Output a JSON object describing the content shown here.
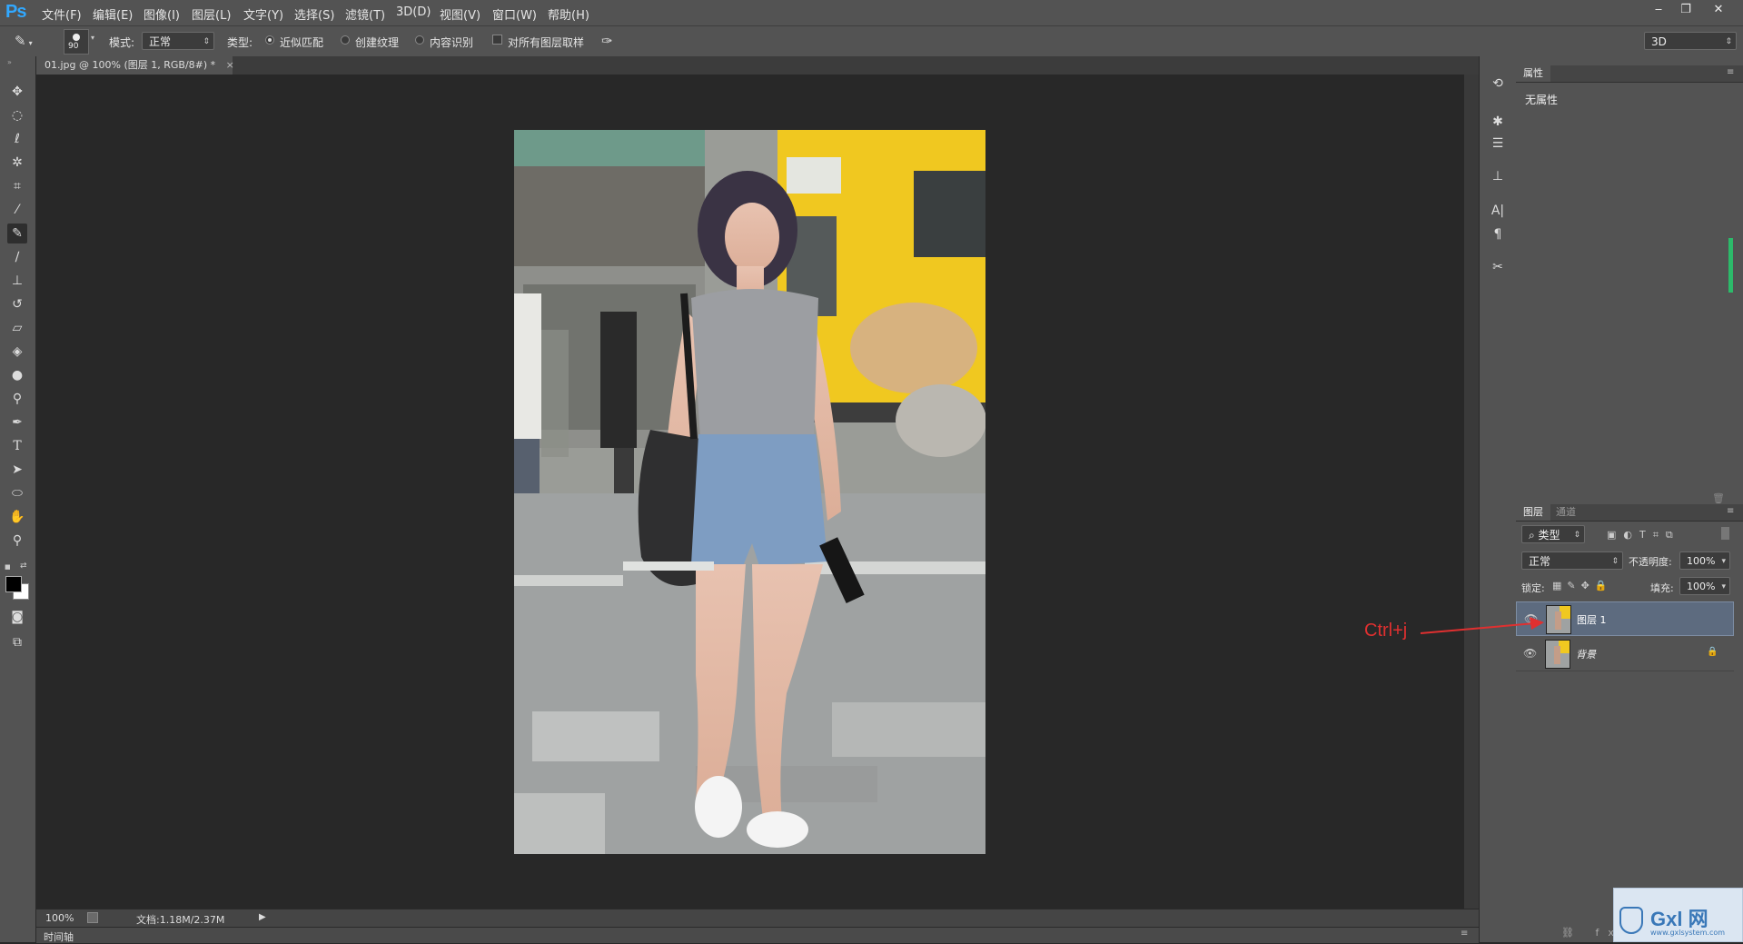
{
  "app": {
    "logo": "Ps"
  },
  "menu": [
    "文件(F)",
    "编辑(E)",
    "图像(I)",
    "图层(L)",
    "文字(Y)",
    "选择(S)",
    "滤镜(T)",
    "3D(D)",
    "视图(V)",
    "窗口(W)",
    "帮助(H)"
  ],
  "window_controls": {
    "minimize": "‒",
    "restore": "❐",
    "close": "✕"
  },
  "options": {
    "brush_size": "90",
    "mode_label": "模式:",
    "mode_value": "正常",
    "type_label": "类型:",
    "radio1": "近似匹配",
    "radio2": "创建纹理",
    "radio3": "内容识别",
    "sample_all": "对所有图层取样",
    "workspace": "3D"
  },
  "document": {
    "tab_title": "01.jpg @ 100% (图层 1, RGB/8#) *",
    "close": "×"
  },
  "status": {
    "zoom": "100%",
    "doc_info": "文档:1.18M/2.37M",
    "timeline": "时间轴"
  },
  "properties": {
    "tab": "属性",
    "content": "无属性"
  },
  "layers_panel": {
    "tab_layers": "图层",
    "tab_channels": "通道",
    "filter": "类型",
    "blend_mode": "正常",
    "opacity_label": "不透明度:",
    "opacity": "100%",
    "lock_label": "锁定:",
    "fill_label": "填充:",
    "fill": "100%",
    "layers": [
      {
        "name": "图层 1",
        "selected": true
      },
      {
        "name": "背景",
        "selected": false
      }
    ]
  },
  "annotation": {
    "text": "Ctrl+j",
    "color": "#e03030"
  },
  "watermark": {
    "line1": "Gxl 网",
    "line2": "www.gxlsystem.com"
  },
  "colors": {
    "ui_panel": "#535353",
    "canvas_bg": "#282828",
    "selected_layer": "#5d6b7f"
  }
}
